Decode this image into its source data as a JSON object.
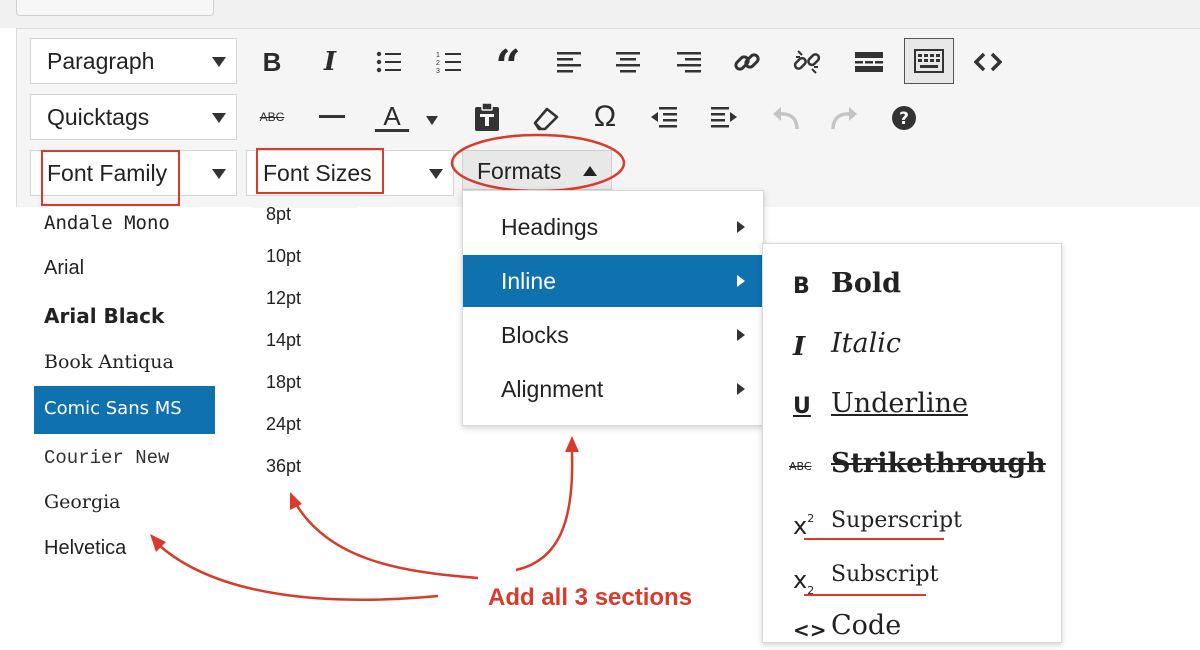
{
  "toolbar": {
    "row1": {
      "block_select": "Paragraph",
      "bold": "B",
      "italic": "I",
      "blockquote": "“"
    },
    "row2": {
      "quicktags_select": "Quicktags",
      "strike_small": "ABC",
      "text_color": "A",
      "special_char": "Ω"
    },
    "row3": {
      "font_family": "Font Family",
      "font_sizes": "Font Sizes",
      "formats": "Formats"
    }
  },
  "font_family_list": [
    "Andale Mono",
    "Arial",
    "Arial Black",
    "Book Antiqua",
    "Comic Sans MS",
    "Courier New",
    "Georgia",
    "Helvetica"
  ],
  "font_family_selected": "Comic Sans MS",
  "font_sizes_list": [
    "8pt",
    "10pt",
    "12pt",
    "14pt",
    "18pt",
    "24pt",
    "36pt"
  ],
  "formats_menu": [
    "Headings",
    "Inline",
    "Blocks",
    "Alignment"
  ],
  "formats_active": "Inline",
  "inline_submenu": {
    "bold": {
      "glyph": "B",
      "label": "Bold"
    },
    "italic": {
      "glyph": "I",
      "label": "Italic"
    },
    "underline": {
      "glyph": "U",
      "label": "Underline"
    },
    "strikethrough": {
      "glyph": "ABC",
      "label": "Strikethrough"
    },
    "superscript": {
      "glyph": "x",
      "sup": "2",
      "label": "Superscript"
    },
    "subscript": {
      "glyph": "x",
      "sub": "2",
      "label": "Subscript"
    },
    "code": {
      "glyph": "<>",
      "label": "Code"
    }
  },
  "annotation": "Add all 3 sections",
  "colors": {
    "accent": "#0f72ae",
    "annotation_red": "#d93a2b",
    "toolbar_bg": "#f5f5f5"
  }
}
